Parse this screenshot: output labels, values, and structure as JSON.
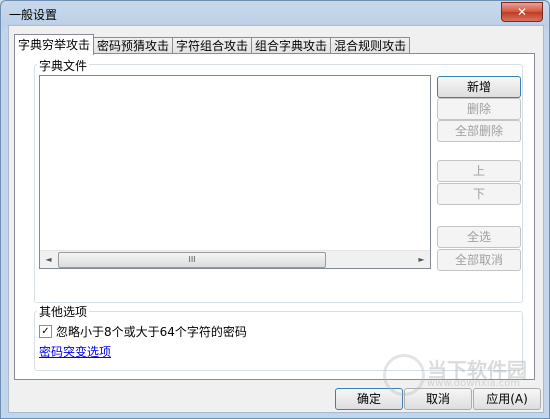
{
  "window": {
    "title": "一般设置",
    "close_glyph": "✕"
  },
  "tabs": [
    {
      "label": "字典穷举攻击",
      "active": true
    },
    {
      "label": "密码预猜攻击",
      "active": false
    },
    {
      "label": "字符组合攻击",
      "active": false
    },
    {
      "label": "组合字典攻击",
      "active": false
    },
    {
      "label": "混合规则攻击",
      "active": false
    }
  ],
  "dict_files": {
    "group_label": "字典文件",
    "buttons": {
      "add": "新增",
      "delete": "删除",
      "delete_all": "全部删除",
      "up": "上",
      "down": "下",
      "select_all": "全选",
      "deselect_all": "全部取消"
    },
    "scroll": {
      "left": "◄",
      "right": "►",
      "thumb_grip": "III"
    }
  },
  "other_options": {
    "group_label": "其他选项",
    "ignore_checkbox": {
      "checked": true,
      "label": "忽略小于8个或大于64个字符的密码"
    },
    "mutation_link": "密码突变选项"
  },
  "footer": {
    "ok": "确定",
    "cancel": "取消",
    "apply": "应用(A)"
  },
  "watermark": {
    "text": "当下软件园",
    "url": "www.downxia.com"
  }
}
